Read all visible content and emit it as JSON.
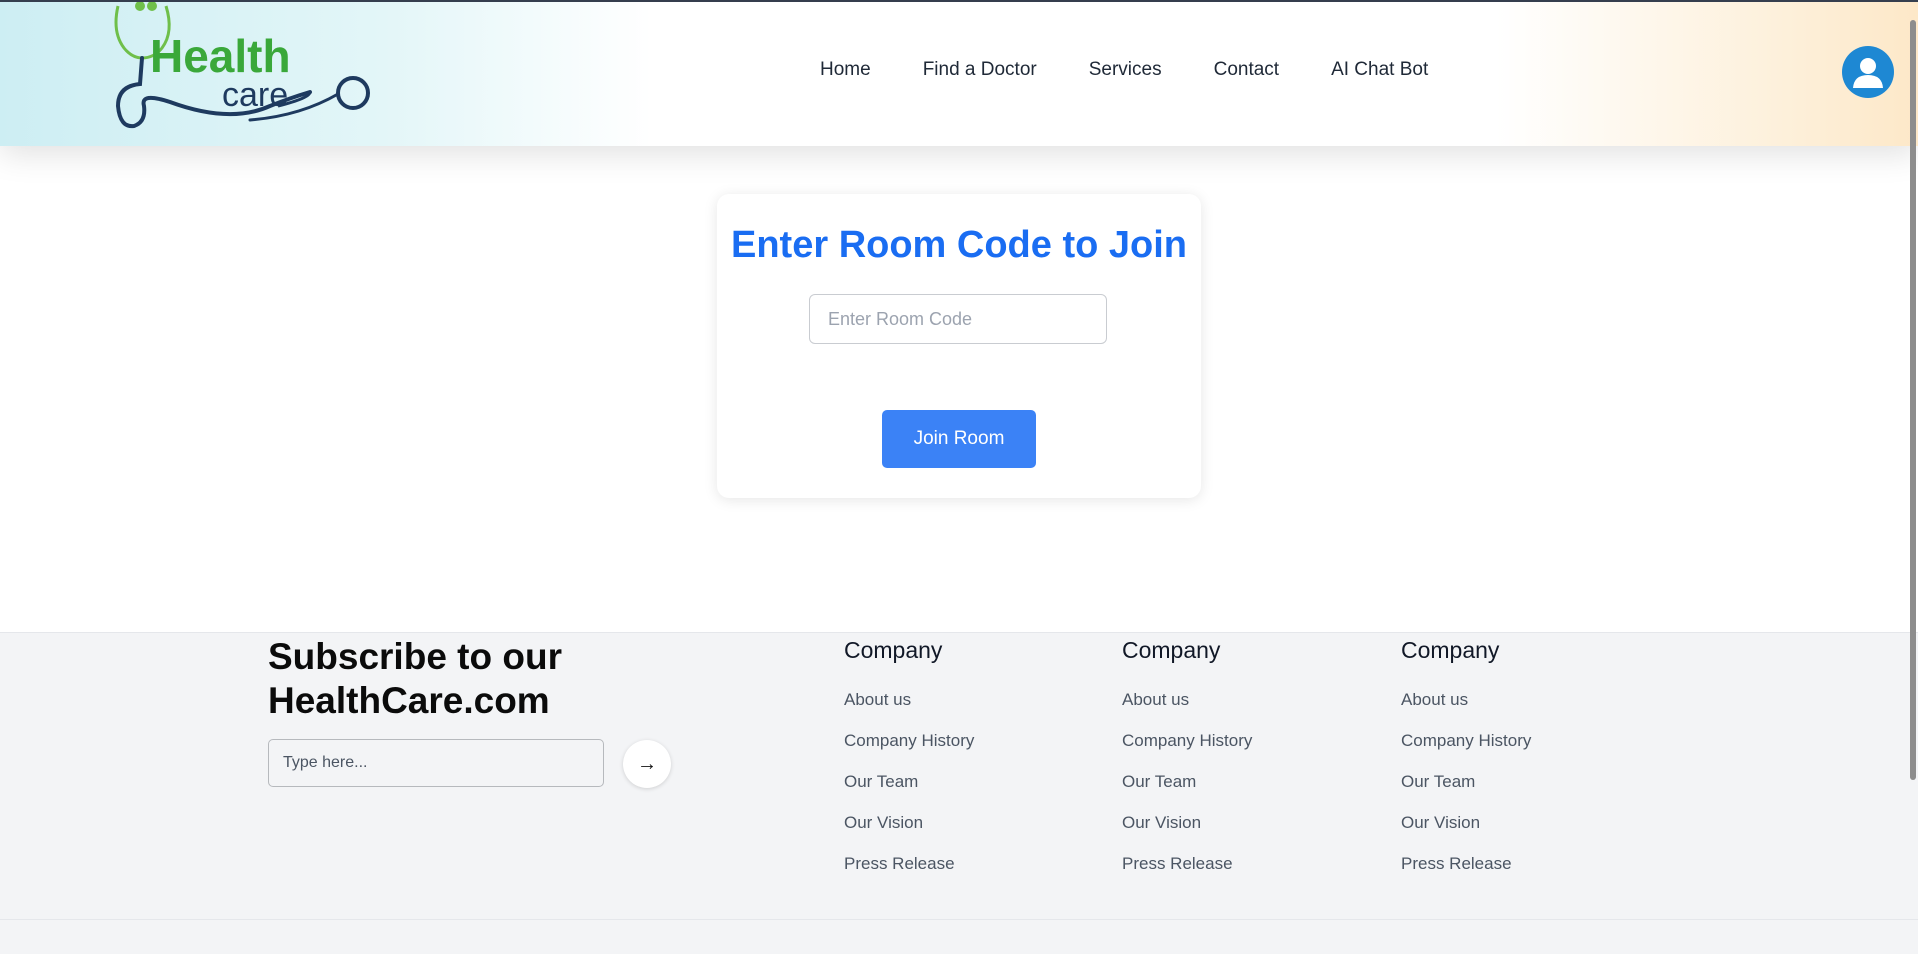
{
  "header": {
    "logo": {
      "line1": "Health",
      "line2": "care"
    },
    "nav": [
      "Home",
      "Find a Doctor",
      "Services",
      "Contact",
      "AI Chat Bot"
    ]
  },
  "room": {
    "title": "Enter Room Code to Join",
    "input_placeholder": "Enter Room Code",
    "join_label": "Join Room"
  },
  "footer": {
    "subscribe_title": "Subscribe to our HealthCare.com",
    "subscribe_placeholder": "Type here...",
    "submit_icon": "arrow-right-icon",
    "columns": [
      {
        "title": "Company",
        "links": [
          "About us",
          "Company History",
          "Our Team",
          "Our Vision",
          "Press Release"
        ]
      },
      {
        "title": "Company",
        "links": [
          "About us",
          "Company History",
          "Our Team",
          "Our Vision",
          "Press Release"
        ]
      },
      {
        "title": "Company",
        "links": [
          "About us",
          "Company History",
          "Our Team",
          "Our Vision",
          "Press Release"
        ]
      }
    ]
  },
  "colors": {
    "accent_blue": "#1a6df2",
    "button_blue": "#3b82f6",
    "logo_green": "#3aa83a",
    "logo_navy": "#1e3a5f",
    "avatar_blue": "#1e88d3"
  }
}
